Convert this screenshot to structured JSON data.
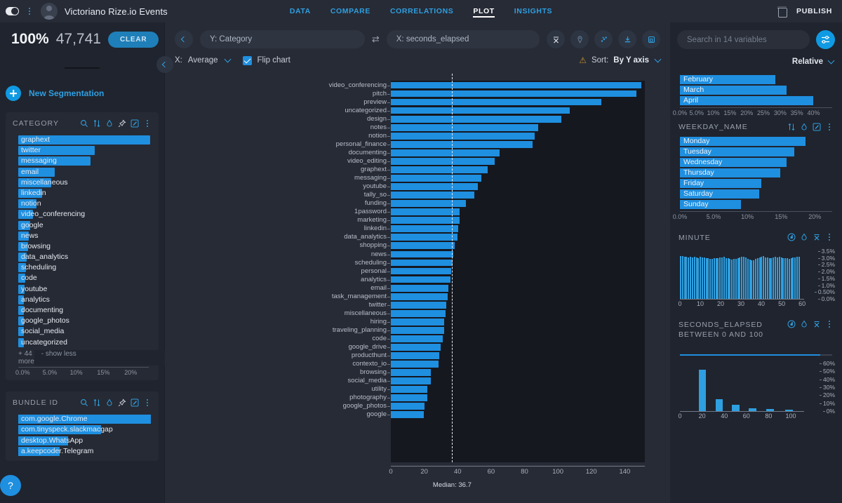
{
  "header": {
    "title": "Victoriano Rize.io Events",
    "tabs": [
      {
        "label": "DATA",
        "active": false
      },
      {
        "label": "COMPARE",
        "active": false
      },
      {
        "label": "CORRELATIONS",
        "active": false
      },
      {
        "label": "PLOT",
        "active": true
      },
      {
        "label": "INSIGHTS",
        "active": false
      }
    ],
    "publish_label": "PUBLISH",
    "trash_icon": "trash-icon",
    "logo_icon": "graphext-logo-icon",
    "menu_icon": "vertical-dots-icon",
    "avatar_icon": "avatar-icon"
  },
  "left": {
    "percent": "100%",
    "count": "47,741",
    "clear_label": "CLEAR",
    "new_segmentation": "New Segmentation",
    "panels": [
      {
        "title": "CATEGORY",
        "icons": [
          "search-icon",
          "sort-icon",
          "droplet-icon",
          "pin-icon",
          "edit-icon",
          "more-icon"
        ],
        "items": [
          {
            "label": "graphext",
            "pct": 23.5
          },
          {
            "label": "twitter",
            "pct": 13.6
          },
          {
            "label": "messaging",
            "pct": 12.9
          },
          {
            "label": "email",
            "pct": 6.5
          },
          {
            "label": "miscellaneous",
            "pct": 5.9
          },
          {
            "label": "linkedin",
            "pct": 4.2
          },
          {
            "label": "notion",
            "pct": 3.3
          },
          {
            "label": "video_conferencing",
            "pct": 2.6
          },
          {
            "label": "google",
            "pct": 2.1
          },
          {
            "label": "news",
            "pct": 1.9
          },
          {
            "label": "browsing",
            "pct": 1.7
          },
          {
            "label": "data_analytics",
            "pct": 1.5
          },
          {
            "label": "scheduling",
            "pct": 1.4
          },
          {
            "label": "code",
            "pct": 1.2
          },
          {
            "label": "youtube",
            "pct": 1.1
          },
          {
            "label": "analytics",
            "pct": 1.0
          },
          {
            "label": "documenting",
            "pct": 0.9
          },
          {
            "label": "google_photos",
            "pct": 0.8
          },
          {
            "label": "social_media",
            "pct": 0.8
          },
          {
            "label": "uncategorized",
            "pct": 0.7
          }
        ],
        "more_label": "+ 44 more",
        "less_label": "- show less",
        "axis_ticks": [
          "0.0%",
          "5.0%",
          "10%",
          "15%",
          "20%"
        ],
        "axis_max": 24
      },
      {
        "title": "BUNDLE ID",
        "icons": [
          "search-icon",
          "sort-icon",
          "droplet-icon",
          "pin-icon",
          "edit-icon",
          "more-icon"
        ],
        "items": [
          {
            "label": "com.google.Chrome",
            "pct": 96
          },
          {
            "label": "com.tinyspeck.slackmacgap",
            "pct": 60
          },
          {
            "label": "desktop.WhatsApp",
            "pct": 36
          },
          {
            "label": "a.keepcoder.Telegram",
            "pct": 30
          }
        ]
      }
    ],
    "help_label": "?"
  },
  "plot": {
    "back_icon": "chevron-left-icon",
    "y_field": "Y: Category",
    "x_field": "X: seconds_elapsed",
    "swap_icon": "swap-axes-icon",
    "tools": [
      "mean-icon",
      "pin-icon",
      "scatter-icon",
      "download-icon",
      "expand-icon"
    ],
    "aggregation_label": "X:",
    "aggregation_value": "Average",
    "flip_chart_label": "Flip chart",
    "flip_chart_checked": true,
    "warning_icon": "warning-icon",
    "sort_label": "Sort:",
    "sort_value": "By Y axis",
    "median_label": "Median: 36.7",
    "median_value": 36.7
  },
  "chart_data": {
    "type": "bar",
    "title": "",
    "xlabel": "seconds_elapsed",
    "ylabel": "Category",
    "orientation": "horizontal",
    "xlim": [
      0,
      152
    ],
    "xticks": [
      0,
      20,
      40,
      60,
      80,
      100,
      120,
      140
    ],
    "median": 36.7,
    "grid": false,
    "categories": [
      "video_conferencing",
      "pitch",
      "preview",
      "uncategorized",
      "design",
      "notes",
      "notion",
      "personal_finance",
      "documenting",
      "video_editing",
      "graphext",
      "messaging",
      "youtube",
      "tally_so",
      "funding",
      "1password",
      "marketing",
      "linkedin",
      "data_analytics",
      "shopping",
      "news",
      "scheduling",
      "personal",
      "analytics",
      "email",
      "task_management",
      "twitter",
      "miscellaneous",
      "hiring",
      "traveling_planning",
      "code",
      "google_drive",
      "producthunt",
      "contexto_io",
      "browsing",
      "social_media",
      "utility",
      "photography",
      "google_photos",
      "google"
    ],
    "values": [
      150.0,
      147.0,
      126.0,
      107.0,
      102.0,
      88.0,
      86.0,
      85.0,
      65.0,
      62.0,
      58.0,
      54.0,
      52.0,
      50.0,
      45.0,
      41.0,
      41.0,
      40.5,
      40.0,
      38.0,
      37.5,
      37.0,
      36.0,
      35.5,
      34.5,
      34.0,
      33.0,
      32.8,
      32.0,
      32.0,
      31.0,
      30.0,
      29.0,
      28.5,
      24.0,
      24.0,
      22.0,
      21.8,
      20.0,
      19.8
    ]
  },
  "right": {
    "search_placeholder": "Search in 14 variables",
    "filter_icon": "sliders-icon",
    "relative_label": "Relative",
    "panels": [
      {
        "title": "",
        "icons": [],
        "type": "bar",
        "items": [
          {
            "label": "February",
            "pct": 28.5
          },
          {
            "label": "March",
            "pct": 32.0
          },
          {
            "label": "April",
            "pct": 40.0
          }
        ],
        "axis_ticks": [
          "0.0%",
          "5.0%",
          "10%",
          "15%",
          "20%",
          "25%",
          "30%",
          "35%",
          "40%"
        ],
        "axis_max": 42
      },
      {
        "title": "WEEKDAY_NAME",
        "icons": [
          "sort-icon",
          "droplet-icon",
          "edit-icon",
          "more-icon"
        ],
        "type": "bar",
        "items": [
          {
            "label": "Monday",
            "pct": 18.6
          },
          {
            "label": "Tuesday",
            "pct": 17.0
          },
          {
            "label": "Wednesday",
            "pct": 15.8
          },
          {
            "label": "Thursday",
            "pct": 14.9
          },
          {
            "label": "Friday",
            "pct": 12.1
          },
          {
            "label": "Saturday",
            "pct": 11.8
          },
          {
            "label": "Sunday",
            "pct": 9.0
          }
        ],
        "axis_ticks": [
          "0.0%",
          "5.0%",
          "10%",
          "15%",
          "20%"
        ],
        "axis_max": 20.8
      }
    ],
    "histograms": [
      {
        "title": "MINUTE",
        "icons": [
          "histogram-icon",
          "droplet-icon",
          "mean-icon",
          "more-icon"
        ],
        "xticks": [
          0,
          10,
          20,
          30,
          40,
          50,
          60
        ],
        "xlim": [
          0,
          61
        ],
        "ylim": [
          0,
          3.5
        ],
        "yticks": [
          "3.5%",
          "3.0%",
          "2.5%",
          "2.0%",
          "1.5%",
          "1.0%",
          "0.50%",
          "0.0%"
        ],
        "values": [
          3.32,
          3.35,
          3.3,
          3.3,
          3.25,
          3.28,
          3.22,
          3.3,
          3.25,
          3.2,
          3.28,
          3.22,
          3.25,
          3.2,
          3.15,
          3.1,
          3.12,
          3.18,
          3.2,
          3.18,
          3.22,
          3.25,
          3.28,
          3.2,
          3.18,
          3.1,
          3.05,
          3.12,
          3.1,
          3.2,
          3.25,
          3.3,
          3.28,
          3.22,
          3.1,
          3.05,
          3.0,
          3.02,
          3.1,
          3.18,
          3.25,
          3.3,
          3.32,
          3.25,
          3.22,
          3.2,
          3.18,
          3.25,
          3.28,
          3.22,
          3.3,
          3.25,
          3.2,
          3.18,
          3.15,
          3.12,
          3.18,
          3.22,
          3.25,
          3.3,
          3.28
        ]
      },
      {
        "title": "SECONDS_ELAPSED BETWEEN 0 AND 100",
        "icons": [
          "histogram-icon",
          "droplet-icon",
          "mean-icon",
          "more-icon"
        ],
        "has_slider": true,
        "xticks": [
          0,
          20,
          40,
          60,
          80,
          100
        ],
        "xlim": [
          0,
          112
        ],
        "ylim": [
          0,
          62
        ],
        "yticks": [
          "60%",
          "50%",
          "40%",
          "30%",
          "20%",
          "10%",
          "0%"
        ],
        "bars": [
          {
            "x": 17,
            "value": 57
          },
          {
            "x": 32,
            "value": 16
          },
          {
            "x": 47,
            "value": 9
          },
          {
            "x": 62,
            "value": 4
          },
          {
            "x": 78,
            "value": 3
          },
          {
            "x": 95,
            "value": 2
          }
        ]
      }
    ]
  },
  "colors": {
    "accent": "#1f8fe0",
    "bg": "#20242e",
    "panel": "#262a34",
    "plot_bg": "#15181f",
    "link": "#2e9fe0"
  }
}
